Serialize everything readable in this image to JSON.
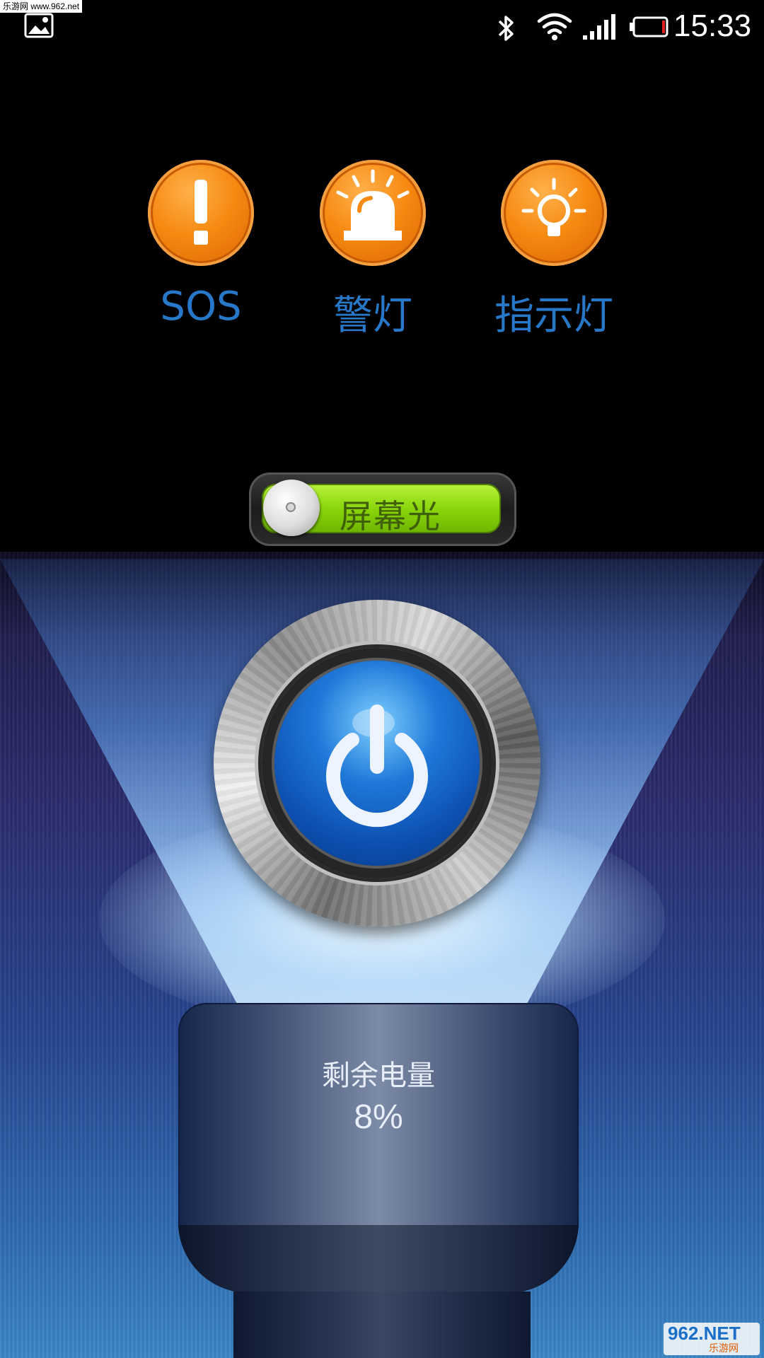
{
  "status_bar": {
    "time": "15:33",
    "icons": [
      "gallery-icon",
      "bluetooth-icon",
      "wifi-icon",
      "signal-icon",
      "battery-low-icon"
    ],
    "watermark_text": "乐游网 www.962.net"
  },
  "modes": [
    {
      "label": "SOS",
      "icon": "exclamation-icon"
    },
    {
      "label": "警灯",
      "icon": "siren-icon"
    },
    {
      "label": "指示灯",
      "icon": "lightbulb-icon"
    }
  ],
  "screen_light_toggle": {
    "label": "屏幕光",
    "on": true
  },
  "power_button": {
    "icon": "power-icon"
  },
  "battery": {
    "title": "剩余电量",
    "value": "8%"
  },
  "watermark": {
    "main": "962.NET",
    "sub": "乐游网"
  },
  "colors": {
    "accent_orange": "#f68a12",
    "label_blue": "#2778c8",
    "toggle_green": "#8ad60c",
    "power_blue": "#1f78d8"
  }
}
